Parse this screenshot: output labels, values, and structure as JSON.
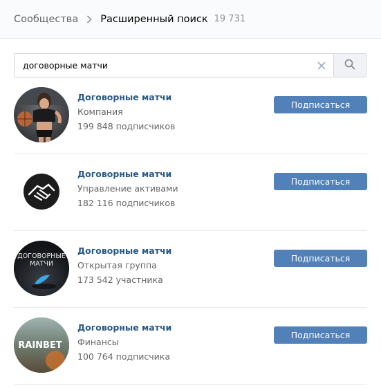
{
  "header": {
    "breadcrumb": "Сообщества",
    "title": "Расширенный поиск",
    "count": "19 731"
  },
  "search": {
    "value": "договорные матчи",
    "placeholder": ""
  },
  "results": [
    {
      "name": "Договорные матчи",
      "category": "Компания",
      "members": "199 848 подписчиков",
      "button": "Подписаться",
      "avatar_icon": "woman-basketball-photo"
    },
    {
      "name": "Договорные матчи",
      "category": "Управление активами",
      "members": "182 116 подписчиков",
      "button": "Подписаться",
      "avatar_icon": "handshake-icon"
    },
    {
      "name": "Договорные матчи",
      "category": "Открытая группа",
      "members": "173 542 участника",
      "button": "Подписаться",
      "avatar_text": "ДОГОВОРНЫЕ МАТЧИ"
    },
    {
      "name": "Договорные матчи",
      "category": "Финансы",
      "members": "100 764 подписчика",
      "button": "Подписаться",
      "avatar_text": "RAINBET"
    }
  ],
  "colors": {
    "link": "#2a5885",
    "button": "#5181b8",
    "muted": "#656565"
  }
}
